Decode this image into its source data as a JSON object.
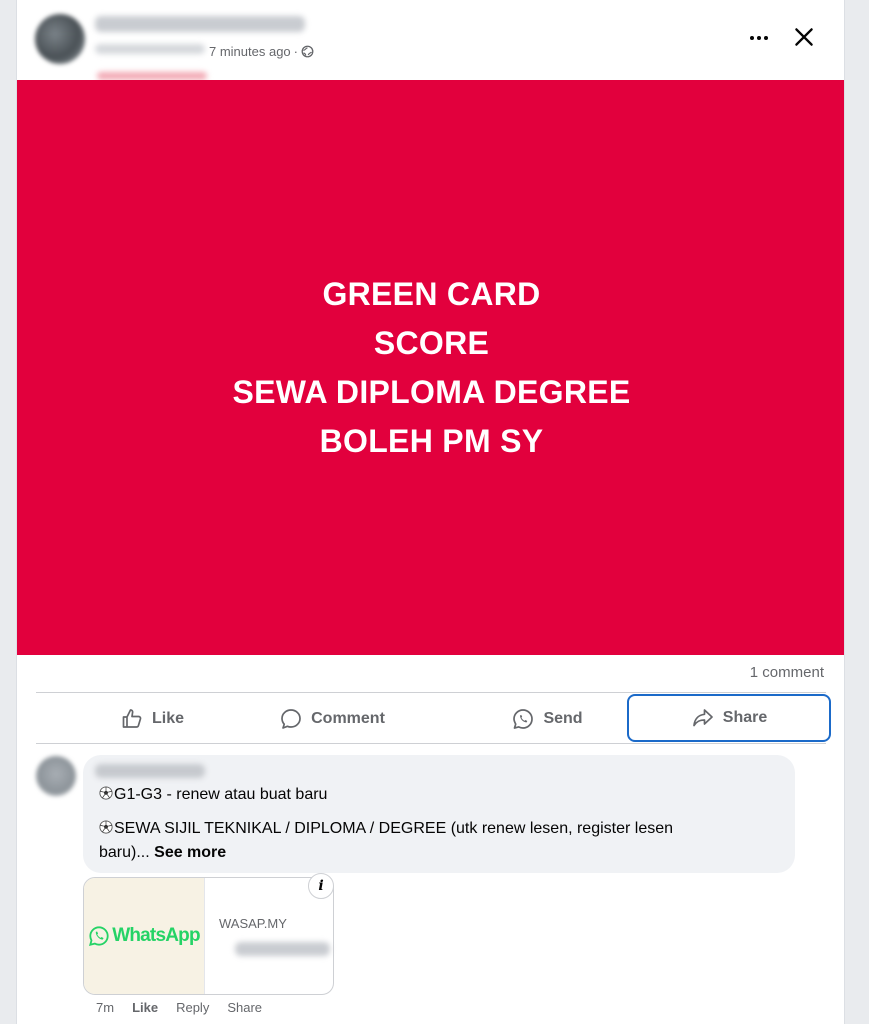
{
  "post": {
    "time": "7 minutes ago",
    "separator": "·",
    "image_lines": [
      "GREEN CARD",
      "SCORE",
      "SEWA DIPLOMA DEGREE",
      "BOLEH PM SY"
    ],
    "image_bg": "#e2003d",
    "comment_count": "1 comment"
  },
  "actions": {
    "like": "Like",
    "comment": "Comment",
    "send": "Send",
    "share": "Share"
  },
  "comment": {
    "line1": "G1-G3 - renew atau buat baru",
    "line2": "SEWA SIJIL TEKNIKAL / DIPLOMA / DEGREE (utk renew lesen, register lesen",
    "line3": "baru)...",
    "see_more": "See more",
    "link_brand": "WhatsApp",
    "link_domain": "WASAP.MY",
    "info": "i",
    "age": "7m",
    "like": "Like",
    "reply": "Reply",
    "share": "Share"
  },
  "icons": {
    "privacy": "globe-icon",
    "menu": "more-horizontal-icon",
    "close": "close-icon",
    "bullet": "soccer-ball-icon"
  },
  "colors": {
    "accent": "#1b6ac9",
    "whatsapp": "#25d366"
  }
}
